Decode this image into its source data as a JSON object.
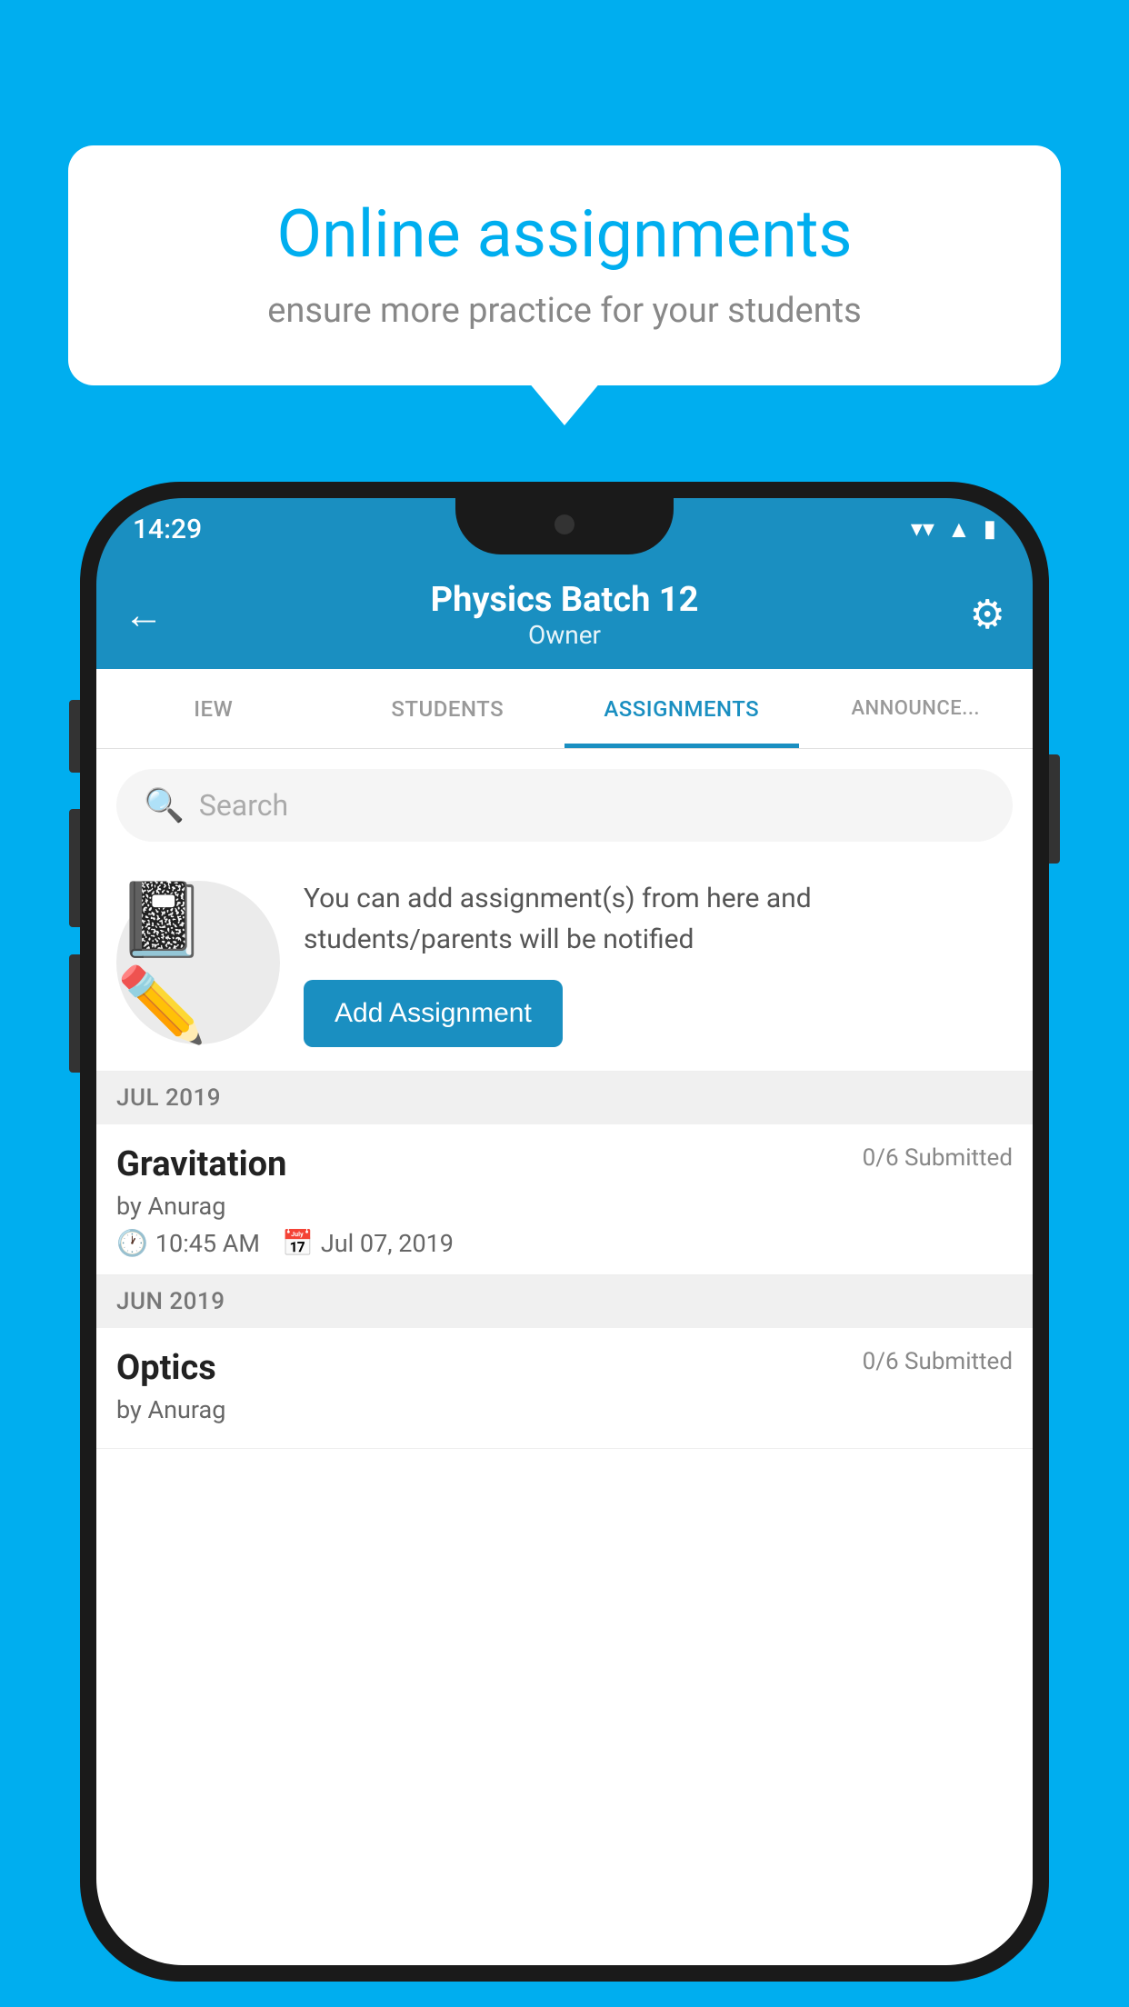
{
  "background": {
    "color": "#00AEEF"
  },
  "speech_bubble": {
    "title": "Online assignments",
    "subtitle": "ensure more practice for your students"
  },
  "phone": {
    "status_bar": {
      "time": "14:29",
      "wifi": "▲",
      "signal": "▲",
      "battery": "▪"
    },
    "app_bar": {
      "title": "Physics Batch 12",
      "subtitle": "Owner",
      "back_label": "←",
      "settings_label": "⚙"
    },
    "tabs": [
      {
        "label": "IEW",
        "active": false
      },
      {
        "label": "STUDENTS",
        "active": false
      },
      {
        "label": "ASSIGNMENTS",
        "active": true
      },
      {
        "label": "ANNOUNCEMENTS",
        "active": false
      }
    ],
    "search": {
      "placeholder": "Search"
    },
    "promo": {
      "description": "You can add assignment(s) from here and students/parents will be notified",
      "button_label": "Add Assignment"
    },
    "sections": [
      {
        "month": "JUL 2019",
        "assignments": [
          {
            "title": "Gravitation",
            "submitted": "0/6 Submitted",
            "by": "by Anurag",
            "time": "10:45 AM",
            "date": "Jul 07, 2019"
          }
        ]
      },
      {
        "month": "JUN 2019",
        "assignments": [
          {
            "title": "Optics",
            "submitted": "0/6 Submitted",
            "by": "by Anurag",
            "time": "",
            "date": ""
          }
        ]
      }
    ]
  }
}
